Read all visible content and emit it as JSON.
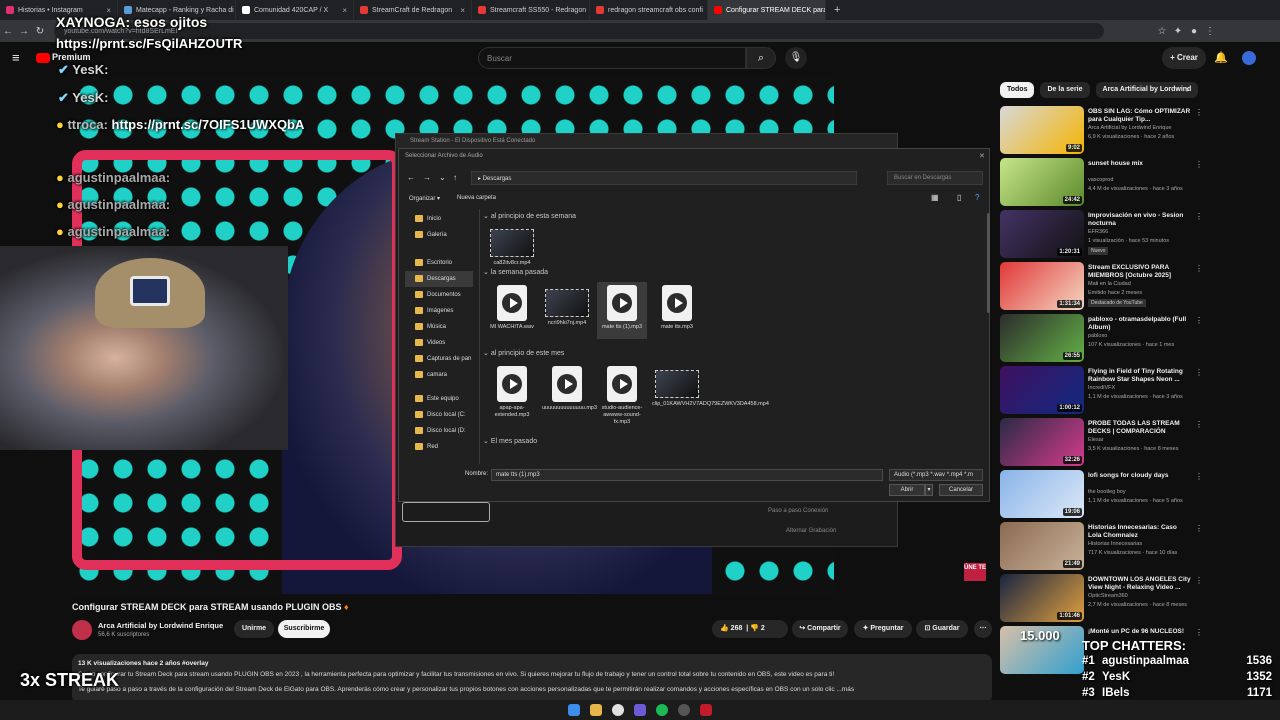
{
  "browser": {
    "tabs": [
      {
        "label": "Historias • Instagram",
        "color": "#e1306c"
      },
      {
        "label": "Matecapp - Ranking y Racha di",
        "color": "#5a9bd5"
      },
      {
        "label": "Comunidad 420CAP / X",
        "color": "#ffffff"
      },
      {
        "label": "StreamCraft de Redragon",
        "color": "#e53935"
      },
      {
        "label": "Streamcraft SS550 - Redragon",
        "color": "#e53935"
      },
      {
        "label": "redragon streamcraft obs confi",
        "color": "#e53935"
      },
      {
        "label": "Configurar STREAM DECK para",
        "color": "#ff0000",
        "active": true
      }
    ],
    "url": "youtube.com/watch?v=htd8SErLmEI"
  },
  "youtube": {
    "logo": "Premium",
    "search_placeholder": "Buscar",
    "create_label": "Crear"
  },
  "overlay": {
    "chat_title": "XAYNOGA: esos ojitos",
    "link_top": "https://prnt.sc/FsQilAHZOUTR",
    "lines": [
      {
        "user": "YesK:",
        "msg": ""
      },
      {
        "user": "YesK:",
        "msg": ""
      },
      {
        "user": "ttroca:",
        "msg": "https://prnt.sc/7OIFS1UWXQbA"
      },
      {
        "user": "agustinpaalmaa:",
        "msg": ""
      },
      {
        "user": "agustinpaalmaa:",
        "msg": ""
      },
      {
        "user": "agustinpaalmaa:",
        "msg": ""
      }
    ],
    "streak": "3x STREAK",
    "une_label": "ÚNE TE"
  },
  "obs_window": {
    "title": "Stream Station - El Dispositivo Está Conectado",
    "option1": "Paso a paso Conexión",
    "option2": "Alternar Grabación"
  },
  "file_dialog": {
    "title": "Seleccionar Archivo de Audio",
    "path": "Descargas",
    "search_placeholder": "Buscar en Descargas",
    "organize": "Organizar",
    "new_folder": "Nueva carpeta",
    "sidebar": [
      "Inicio",
      "Galería",
      "Escritorio",
      "Descargas",
      "Documentos",
      "Imágenes",
      "Música",
      "Videos",
      "Capturas de pan",
      "camara",
      "Este equipo",
      "Disco local (C:",
      "Disco local (D:",
      "Red"
    ],
    "groups": {
      "this_week": "al principio de esta semana",
      "last_week": "la semana pasada",
      "this_month": "al principio de este mes",
      "last_month": "El mes pasado"
    },
    "files_week": [
      "ca82itv8cr.mp4"
    ],
    "files_last_week": [
      "MI WACHITA.wav",
      "ncri9hki7nj.mp4",
      "mate tts (1).mp3",
      "mate tts.mp3"
    ],
    "files_month": [
      "apap-apa-extended.mp3",
      "uuuuuuuuuuuuuu.mp3",
      "studio-audience-awwww-sound-fx.mp3",
      "clip_01KAWVH2V7ADQ79EZWKV3DA458.mp4"
    ],
    "name_label": "Nombre:",
    "name_value": "mate tts (1).mp3",
    "filetype": "Audio (*.mp3 *.wav *.mp4 *.m",
    "open": "Abrir",
    "cancel": "Cancelar"
  },
  "video": {
    "title": "Configurar STREAM DECK para STREAM usando PLUGIN OBS",
    "channel": "Arca Artificial by Lordwind Enrique",
    "subs": "56,6 K suscriptores",
    "member_btn": "Unirme",
    "subscribe_btn": "Suscribirme",
    "likes": "268",
    "dislikes": "2",
    "share": "Compartir",
    "ask": "Preguntar",
    "save": "Guardar",
    "views_line": "13 K visualizaciones  hace 2 años  #overlay",
    "desc1": "Cómo configurar tu Stream Deck para stream usando PLUGIN OBS en 2023 , la herramienta perfecta para optimizar y facilitar tus transmisiones en vivo. Si quieres mejorar tu flujo de trabajo y tener un control total sobre tu contenido en OBS, este video es para ti!",
    "desc2": "Te guiaré paso a paso a través de la configuración del Stream Deck de ElGato para OBS. Aprenderás cómo crear y personalizar tus propios botones con acciones personalizadas que te permitirán realizar comandos y acciones específicas en OBS con un solo clic ...más"
  },
  "chips": [
    "Todos",
    "De la serie",
    "Arca Artificial by Lordwind"
  ],
  "recommendations": [
    {
      "title": "OBS SIN LAG: Cómo OPTIMIZAR para Cualquier Tip...",
      "channel": "Arca Artificial by Lordwind Enrique",
      "meta": "6,9 K visualizaciones · hace 2 años",
      "dur": "9:02",
      "c1": "#d8d8d8",
      "c2": "#f4b400"
    },
    {
      "title": "sunset house mix",
      "channel": "vascoprod",
      "meta": "4,4 M de visualizaciones · hace 3 años",
      "dur": "24:42",
      "c1": "#c7e58a",
      "c2": "#5c8a2c"
    },
    {
      "title": "Improvisación en vivo - Sesion nocturna",
      "channel": "EFR366",
      "meta": "1 visualización · hace 53 minutos",
      "badge": "Nuevo",
      "dur": "1:20:31",
      "c1": "#443366",
      "c2": "#111"
    },
    {
      "title": "Stream EXCLUSIVO PARA MIEMBROS [Octubre 2025]",
      "channel": "Mati en la Ciudad",
      "meta": "Emitido hace 2 meses",
      "badge": "Destacado de YouTube",
      "dur": "1:31:34",
      "c1": "#e23838",
      "c2": "#f2d7c2"
    },
    {
      "title": "pabloxo - otramasdelpablo (Full Album)",
      "channel": "pabloxo",
      "meta": "107 K visualizaciones · hace 1 mes",
      "dur": "26:55",
      "c1": "#2c2c2c",
      "c2": "#63b146"
    },
    {
      "title": "Flying in Field of Tiny Rotating Rainbow Star Shapes Neon ...",
      "channel": "IncrediVFX",
      "meta": "1,1 M de visualizaciones · hace 3 años",
      "dur": "1:00:12",
      "c1": "#401060",
      "c2": "#102a80"
    },
    {
      "title": "PROBÉ TODAS LAS STREAM DECKS | COMPARACIÓN",
      "channel": "Elesar",
      "meta": "3,5 K visualizaciones · hace 8 meses",
      "dur": "32:26",
      "c1": "#2a2a44",
      "c2": "#d63b8c"
    },
    {
      "title": "lofi songs for cloudy days",
      "channel": "the bootleg boy",
      "meta": "1,1 M de visualizaciones · hace 5 años",
      "dur": "19:06",
      "c1": "#8ab4e8",
      "c2": "#dbe8f8"
    },
    {
      "title": "Historias Innecesarias: Caso Lola Chomnalez",
      "channel": "Historias Innecesarias",
      "meta": "717 K visualizaciones · hace 10 días",
      "dur": "21:49",
      "c1": "#8c6a52",
      "c2": "#c9b39a"
    },
    {
      "title": "DOWNTOWN LOS ANGELES City View Night - Relaxing Video ...",
      "channel": "OpticStream360",
      "meta": "2,7 M de visualizaciones · hace 8 meses",
      "dur": "1:01:46",
      "c1": "#1a2540",
      "c2": "#e0a040"
    },
    {
      "title": "¡Monté un PC de 96 NÚCLEOS!",
      "channel": "",
      "meta": "",
      "dur": "",
      "c1": "#d8c0a8",
      "c2": "#30a0d0",
      "thumbtext": "15.000"
    }
  ],
  "top_chatters": {
    "title": "TOP CHATTERS:",
    "rows": [
      {
        "rank": "#1",
        "name": "agustinpaalmaa",
        "count": "1536"
      },
      {
        "rank": "#2",
        "name": "YesK",
        "count": "1352"
      },
      {
        "rank": "#3",
        "name": "IBels",
        "count": "1171"
      }
    ]
  }
}
